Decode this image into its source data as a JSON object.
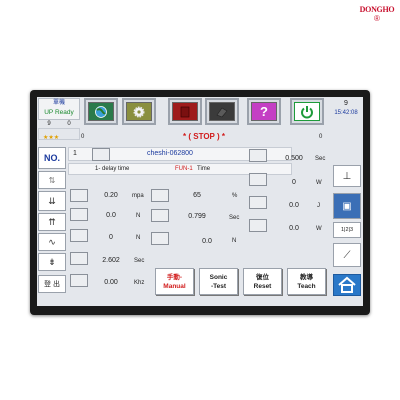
{
  "brand": {
    "logo_text": "DONGHO",
    "logo_mark": "®"
  },
  "header": {
    "status_line1": "單機",
    "status_line2": "UP  Ready",
    "left_counters": [
      "9",
      "0"
    ],
    "stars": "★★★",
    "right_counter": "9",
    "time": "15:42:08",
    "zero_left": "0",
    "zero_right": "0"
  },
  "toolbar": {
    "icons": [
      {
        "name": "globe-icon",
        "color": "#2a7a4a"
      },
      {
        "name": "gear-icon",
        "color": "#8a8f3f"
      },
      {
        "name": "book-icon",
        "color": "#9e1b1b"
      },
      {
        "name": "folder-icon",
        "color": "#3b3b3b"
      },
      {
        "name": "help-icon",
        "color": "#c43fc4"
      },
      {
        "name": "power-icon",
        "color": "#1e9b3a"
      }
    ]
  },
  "run_state": "* ( STOP ) *",
  "colors": {
    "stop": "#d11b1b",
    "accent": "#1b3a9e"
  },
  "left_col": {
    "no_label": "NO.",
    "no_value": "1",
    "bottom_btn": "登 出"
  },
  "program": {
    "name": "cheshi-062800"
  },
  "row_info": {
    "label1": "1- delay time",
    "label2": "FUN-1",
    "label3": "Time"
  },
  "params_left": [
    {
      "value": "0.20",
      "unit": "mpa"
    },
    {
      "value": "0.0",
      "unit": "N"
    },
    {
      "value": "0",
      "unit": "N"
    },
    {
      "value": "2.602",
      "unit": "Sec"
    },
    {
      "value": "0.00",
      "unit": "Khz"
    }
  ],
  "params_mid": [
    {
      "value": "65",
      "unit": "%"
    },
    {
      "value": "0.799",
      "unit": "Sec"
    },
    {
      "value": "0.0",
      "unit": "N"
    }
  ],
  "params_right": [
    {
      "value": "0.500",
      "unit": "Sec"
    },
    {
      "value": "0",
      "unit": "W"
    },
    {
      "value": "0.0",
      "unit": "J"
    },
    {
      "value": "0.0",
      "unit": "W"
    }
  ],
  "buttons": {
    "manual": {
      "cn": "手動-",
      "en": "Manual"
    },
    "sonic": {
      "cn": "Sonic",
      "en": "-Test"
    },
    "reset": {
      "cn": "復位",
      "en": "Reset"
    },
    "teach": {
      "cn": "教導",
      "en": "Teach"
    }
  },
  "side_labels": {
    "step": "1|2|3"
  }
}
